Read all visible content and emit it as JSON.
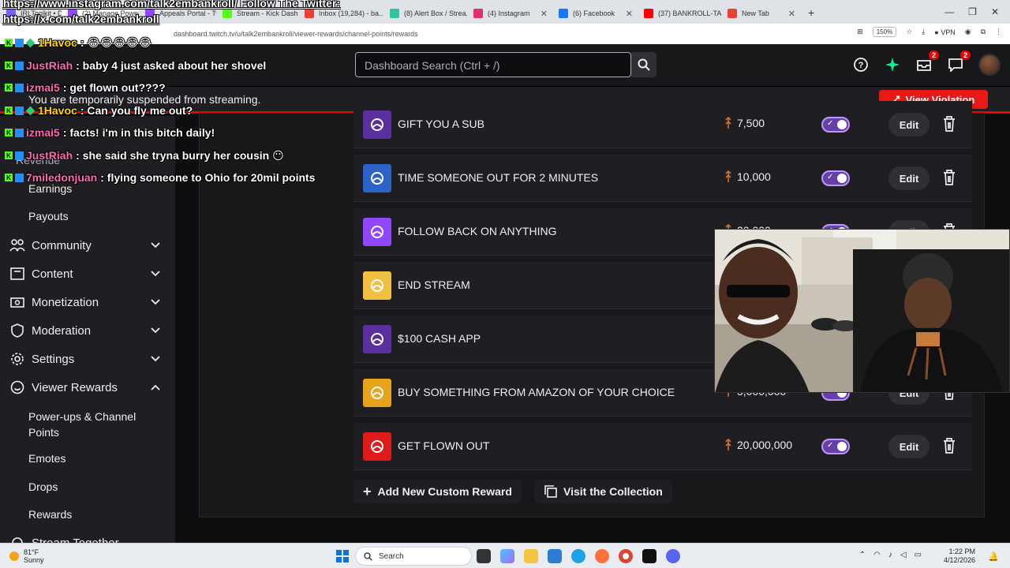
{
  "browser": {
    "tabs": [
      {
        "label": "IRLToolkit • Dashbo...",
        "color": "#7b61ff"
      },
      {
        "label": "(2) Manage Power-...",
        "color": "#9146ff"
      },
      {
        "label": "Appeals Portal - Tw...",
        "color": "#9146ff"
      },
      {
        "label": "Stream - Kick Dashb...",
        "color": "#53fc18"
      },
      {
        "label": "Inbox (19,284) - ba...",
        "color": "#ea4335"
      },
      {
        "label": "(8) Alert Box / Strea...",
        "color": "#31c3a2"
      },
      {
        "label": "(4) Instagram",
        "color": "#e1306c"
      },
      {
        "label": "(6) Facebook",
        "color": "#1877f2"
      },
      {
        "label": "(37) BANKROLL-TA...",
        "color": "#ff0000"
      },
      {
        "label": "New Tab",
        "color": "#ea4335"
      }
    ],
    "url": "dashboard.twitch.tv/u/talk2embankroll/viewer-rewards/channel-points/rewards",
    "zoom": "150%",
    "vpn": "VPN"
  },
  "topnav": {
    "search_placeholder": "Dashboard Search (Ctrl + /)",
    "inbox_badge": "2",
    "whispers_badge": "2"
  },
  "suspension": {
    "message": "You are temporarily suspended from streaming.",
    "button": "View Violation"
  },
  "sidebar": {
    "partial_top": "Revenue",
    "earnings": "Earnings",
    "payouts": "Payouts",
    "items": [
      {
        "label": "Community"
      },
      {
        "label": "Content"
      },
      {
        "label": "Monetization"
      },
      {
        "label": "Moderation"
      },
      {
        "label": "Settings"
      },
      {
        "label": "Viewer Rewards"
      }
    ],
    "sub_items": {
      "powerups": "Power-ups & Channel Points",
      "emotes": "Emotes",
      "drops": "Drops",
      "rewards": "Rewards",
      "cut_off": "Stream Together"
    }
  },
  "rewards": [
    {
      "title": "GIFT YOU A SUB",
      "cost": "7,500",
      "icon_bg": "#5a2fa0"
    },
    {
      "title": "TIME SOMEONE OUT FOR 2 MINUTES",
      "cost": "10,000",
      "icon_bg": "#2d63c8"
    },
    {
      "title": "FOLLOW BACK ON ANYTHING",
      "cost": "20,000",
      "icon_bg": "#9146ff"
    },
    {
      "title": "END STREAM",
      "cost": "",
      "icon_bg": "#f0c040"
    },
    {
      "title": "$100 CASH APP",
      "cost": "",
      "icon_bg": "#5a2fa0"
    },
    {
      "title": "BUY SOMETHING FROM AMAZON OF YOUR CHOICE",
      "cost": "5,000,000",
      "icon_bg": "#e7a41b"
    },
    {
      "title": "GET FLOWN OUT",
      "cost": "20,000,000",
      "icon_bg": "#e01b1b"
    }
  ],
  "reward_actions": {
    "edit": "Edit"
  },
  "bottom_actions": {
    "add": "Add New Custom Reward",
    "visit": "Visit the Collection"
  },
  "chat_overlay": {
    "promo_line1": "https://www.instagram.com/talk2embankroll/ Follow The Twitter:",
    "promo_line2": "https://x.com/talk2embankroll",
    "messages": [
      {
        "user": "1Havoc",
        "text": ": 😂😂😂😂😂",
        "color": "#ffd700"
      },
      {
        "user": "JustRiah",
        "text": ": baby 4 just asked about her shovel",
        "color": "#ff69b4"
      },
      {
        "user": "izmai5",
        "text": ": get flown out????",
        "color": "#ff69b4"
      },
      {
        "user": "1Havoc",
        "text": ": Can you fly me out?",
        "color": "#ffd700"
      },
      {
        "user": "izmai5",
        "text": ": facts! i'm in this bitch daily!",
        "color": "#ff69b4"
      },
      {
        "user": "JustRiah",
        "text": ": she said she tryna burry her cousin 😶",
        "color": "#ff69b4"
      },
      {
        "user": "7miledonjuan",
        "text": ": flying someone to Ohio for 20mil points",
        "color": "#ff69b4"
      }
    ]
  },
  "taskbar": {
    "temp": "81°F",
    "condition": "Sunny",
    "search": "Search",
    "time": "1:22 PM",
    "date": "4/12/2026"
  }
}
